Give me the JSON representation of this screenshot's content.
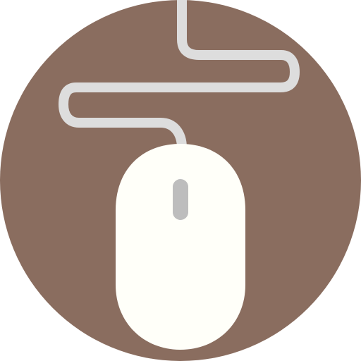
{
  "icon": {
    "name": "computer-mouse-icon",
    "colors": {
      "background_circle": "#8A6D5F",
      "cable": "#DDDDDD",
      "mouse_body": "#FFFFF9",
      "scroll_wheel": "#BDBDBD"
    }
  }
}
